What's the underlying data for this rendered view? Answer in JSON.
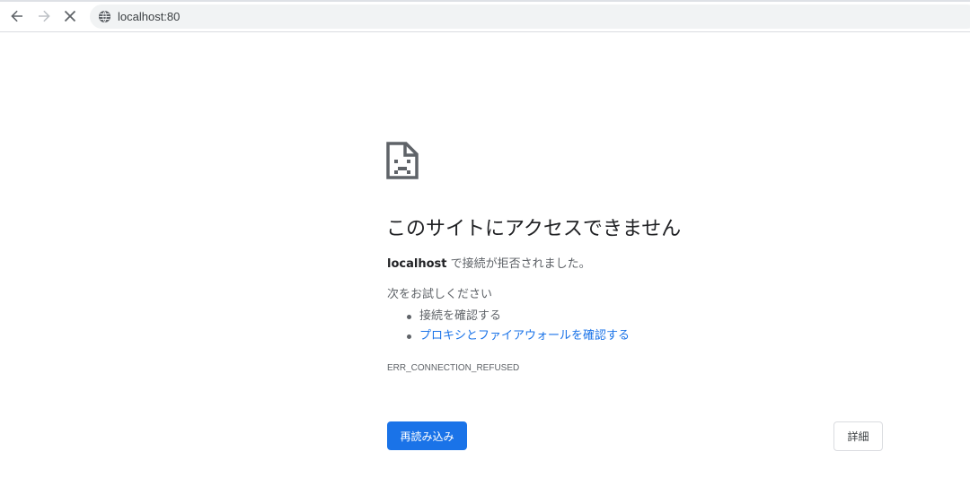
{
  "toolbar": {
    "back_icon": "arrow-left-icon",
    "forward_icon": "arrow-right-icon",
    "stop_icon": "close-icon",
    "site_icon": "globe-icon",
    "url": "localhost:80"
  },
  "error_page": {
    "icon": "sad-page-icon",
    "title": "このサイトにアクセスできません",
    "host": "localhost",
    "message_rest": " で接続が拒否されました。",
    "try_title": "次をお試しください",
    "suggestions": [
      {
        "text": "接続を確認する",
        "is_link": false
      },
      {
        "text": "プロキシとファイアウォールを確認する",
        "is_link": true
      }
    ],
    "error_code": "ERR_CONNECTION_REFUSED",
    "reload_label": "再読み込み",
    "details_label": "詳細"
  },
  "colors": {
    "accent": "#1a73e8",
    "text_primary": "#202124",
    "text_secondary": "#5f6368",
    "omnibox_bg": "#f1f3f4"
  }
}
